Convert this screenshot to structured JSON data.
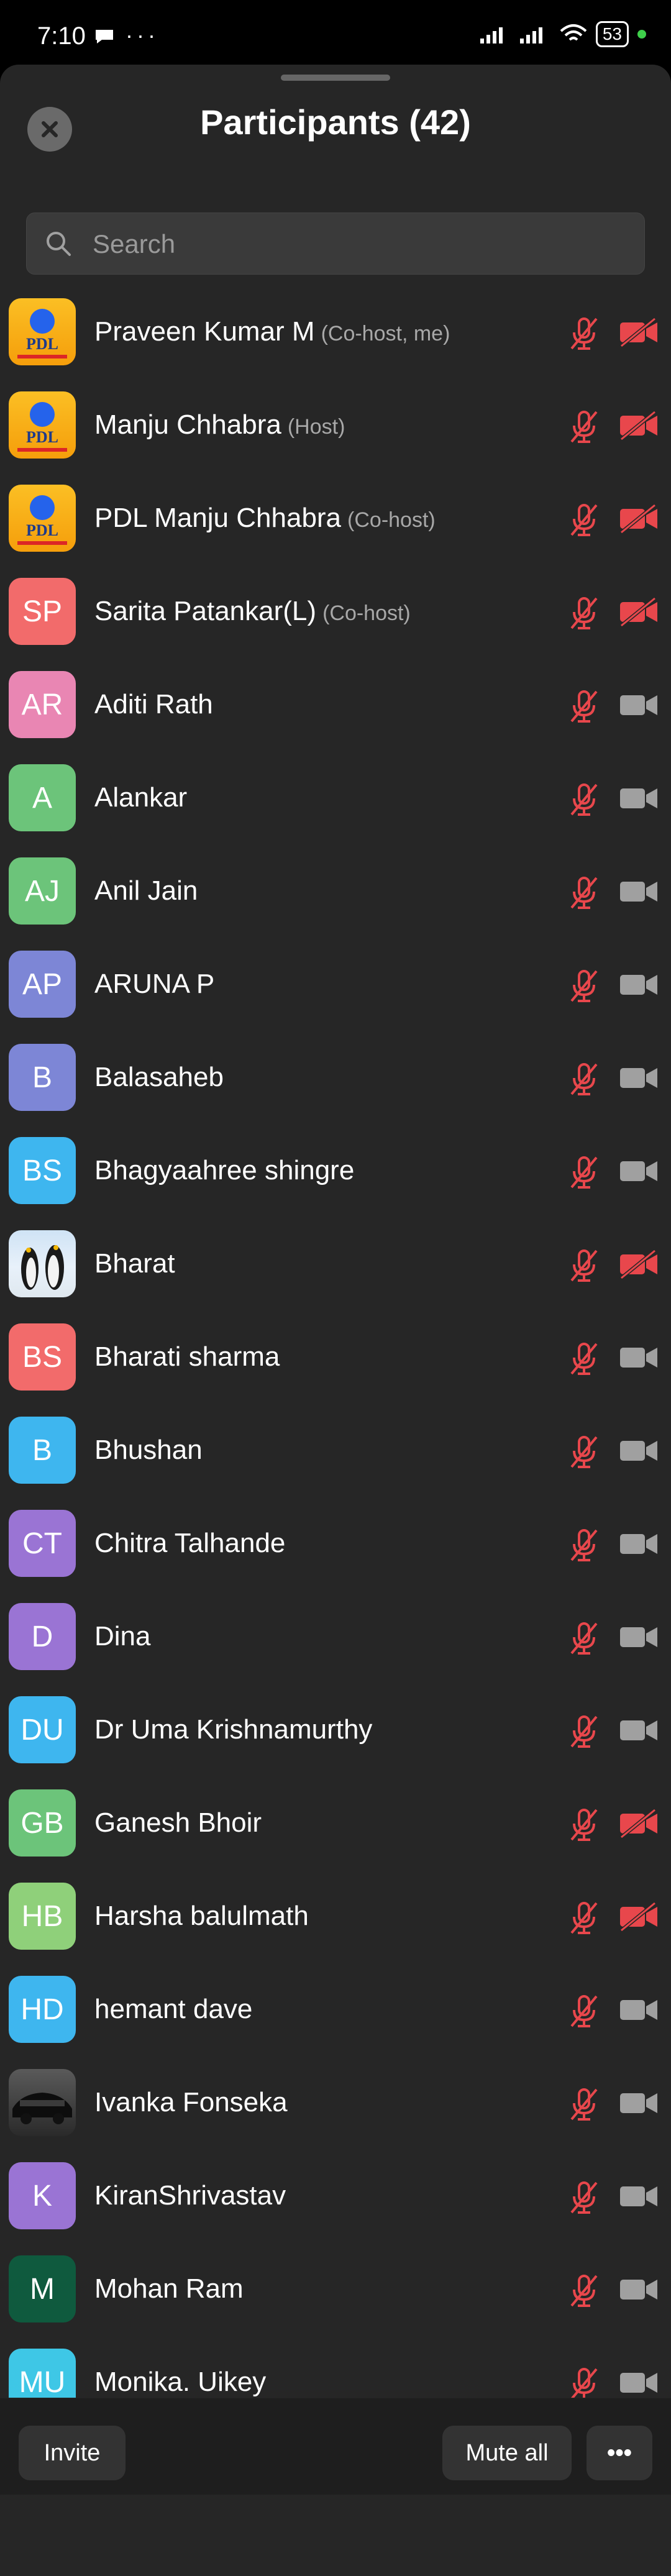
{
  "status_bar": {
    "time": "7:10",
    "battery": "53"
  },
  "header": {
    "title": "Participants (42)"
  },
  "search": {
    "placeholder": "Search"
  },
  "colors": {
    "muted_red": "#e8474c",
    "camera_off_gray": "#a0a0a0",
    "sheet_bg": "#262626"
  },
  "participants": [
    {
      "name": "Praveen Kumar M",
      "role": "(Co-host, me)",
      "avatar": "pdl-logo",
      "avatar_bg": "",
      "video_off_red": true
    },
    {
      "name": "Manju Chhabra",
      "role": "(Host)",
      "avatar": "pdl-logo",
      "avatar_bg": "",
      "video_off_red": true
    },
    {
      "name": "PDL Manju Chhabra",
      "role": "(Co-host)",
      "avatar": "pdl-logo",
      "avatar_bg": "",
      "video_off_red": true
    },
    {
      "name": "Sarita Patankar(L)",
      "role": "(Co-host)",
      "avatar": "SP",
      "avatar_bg": "#f26b6b",
      "video_off_red": true
    },
    {
      "name": "Aditi Rath",
      "role": "",
      "avatar": "AR",
      "avatar_bg": "#e986b3",
      "video_off_red": false
    },
    {
      "name": "Alankar",
      "role": "",
      "avatar": "A",
      "avatar_bg": "#6cc47a",
      "video_off_red": false
    },
    {
      "name": "Anil Jain",
      "role": "",
      "avatar": "AJ",
      "avatar_bg": "#6cc47a",
      "video_off_red": false
    },
    {
      "name": "ARUNA P",
      "role": "",
      "avatar": "AP",
      "avatar_bg": "#7d86d6",
      "video_off_red": false
    },
    {
      "name": "Balasaheb",
      "role": "",
      "avatar": "B",
      "avatar_bg": "#7d86d6",
      "video_off_red": false
    },
    {
      "name": "Bhagyaahree shingre",
      "role": "",
      "avatar": "BS",
      "avatar_bg": "#3eb6ef",
      "video_off_red": false
    },
    {
      "name": "Bharat",
      "role": "",
      "avatar": "penguins-photo",
      "avatar_bg": "",
      "video_off_red": true
    },
    {
      "name": "Bharati sharma",
      "role": "",
      "avatar": "BS",
      "avatar_bg": "#f26b6b",
      "video_off_red": false
    },
    {
      "name": "Bhushan",
      "role": "",
      "avatar": "B",
      "avatar_bg": "#3eb6ef",
      "video_off_red": false
    },
    {
      "name": "Chitra Talhande",
      "role": "",
      "avatar": "CT",
      "avatar_bg": "#9a74d4",
      "video_off_red": false
    },
    {
      "name": "Dina",
      "role": "",
      "avatar": "D",
      "avatar_bg": "#9a74d4",
      "video_off_red": false
    },
    {
      "name": "Dr Uma Krishnamurthy",
      "role": "",
      "avatar": "DU",
      "avatar_bg": "#3eb6ef",
      "video_off_red": false
    },
    {
      "name": "Ganesh Bhoir",
      "role": "",
      "avatar": "GB",
      "avatar_bg": "#6cc47a",
      "video_off_red": true
    },
    {
      "name": "Harsha balulmath",
      "role": "",
      "avatar": "HB",
      "avatar_bg": "#8fd07a",
      "video_off_red": true
    },
    {
      "name": "hemant dave",
      "role": "",
      "avatar": "HD",
      "avatar_bg": "#3eb6ef",
      "video_off_red": false
    },
    {
      "name": "Ivanka Fonseka",
      "role": "",
      "avatar": "car-photo",
      "avatar_bg": "",
      "video_off_red": false
    },
    {
      "name": "KiranShrivastav",
      "role": "",
      "avatar": "K",
      "avatar_bg": "#9a74d4",
      "video_off_red": false
    },
    {
      "name": "Mohan Ram",
      "role": "",
      "avatar": "M",
      "avatar_bg": "#0f5a3e",
      "video_off_red": false
    },
    {
      "name": "Monika. Uikey",
      "role": "",
      "avatar": "MU",
      "avatar_bg": "#3ec7e6",
      "video_off_red": false
    }
  ],
  "footer": {
    "invite_label": "Invite",
    "mute_all_label": "Mute all",
    "more_label": "•••"
  }
}
